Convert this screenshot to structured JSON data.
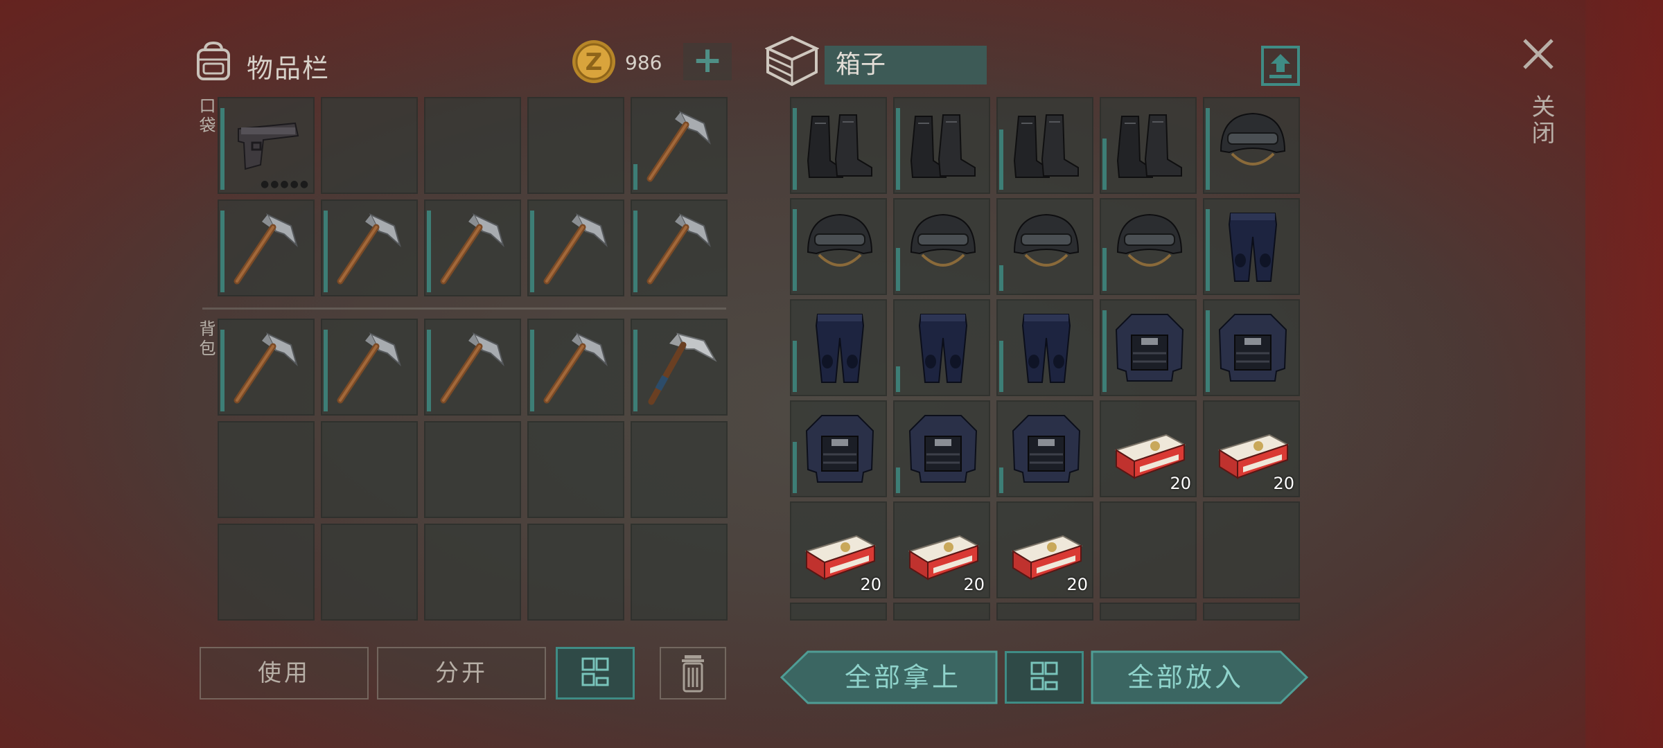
{
  "inventory": {
    "title": "物品栏",
    "coins": "986",
    "add_coins": "+",
    "pocket_label": "口袋",
    "backpack_label": "背包"
  },
  "container": {
    "name": "箱子",
    "close_label": "关闭"
  },
  "inventory_slots": [
    {
      "item": "pistol-icon",
      "bar": 0.95
    },
    {
      "item": "empty"
    },
    {
      "item": "empty"
    },
    {
      "item": "empty"
    },
    {
      "item": "pickaxe-icon",
      "bar": 0.3
    },
    {
      "item": "pickaxe-icon",
      "bar": 0.95
    },
    {
      "item": "pickaxe-icon",
      "bar": 0.95
    },
    {
      "item": "pickaxe-icon",
      "bar": 0.95
    },
    {
      "item": "pickaxe-icon",
      "bar": 0.95
    },
    {
      "item": "pickaxe-icon",
      "bar": 0.95
    },
    {
      "item": "pickaxe-icon",
      "bar": 0.95
    },
    {
      "item": "pickaxe-icon",
      "bar": 0.95
    },
    {
      "item": "pickaxe-icon",
      "bar": 0.95
    },
    {
      "item": "pickaxe-icon",
      "bar": 0.95
    },
    {
      "item": "ice-axe-icon",
      "bar": 0.95
    }
  ],
  "container_slots": [
    {
      "item": "boots-icon",
      "bar": 0.95
    },
    {
      "item": "boots-icon",
      "bar": 0.95
    },
    {
      "item": "boots-icon",
      "bar": 0.7
    },
    {
      "item": "boots-icon",
      "bar": 0.6
    },
    {
      "item": "helmet-icon",
      "bar": 0.95
    },
    {
      "item": "helmet-icon",
      "bar": 0.95
    },
    {
      "item": "helmet-icon",
      "bar": 0.5
    },
    {
      "item": "helmet-icon",
      "bar": 0.3
    },
    {
      "item": "helmet-icon",
      "bar": 0.5
    },
    {
      "item": "pants-icon",
      "bar": 0.95
    },
    {
      "item": "pants-icon",
      "bar": 0.6
    },
    {
      "item": "pants-icon",
      "bar": 0.3
    },
    {
      "item": "pants-icon",
      "bar": 0.6
    },
    {
      "item": "vest-icon",
      "bar": 0.95
    },
    {
      "item": "vest-icon",
      "bar": 0.95
    },
    {
      "item": "vest-icon",
      "bar": 0.6
    },
    {
      "item": "vest-icon",
      "bar": 0.3
    },
    {
      "item": "vest-icon",
      "bar": 0.3
    },
    {
      "item": "cigarettes-icon",
      "qty": "20"
    },
    {
      "item": "cigarettes-icon",
      "qty": "20"
    },
    {
      "item": "cigarettes-icon",
      "qty": "20"
    },
    {
      "item": "cigarettes-icon",
      "qty": "20"
    },
    {
      "item": "cigarettes-icon",
      "qty": "20"
    },
    {
      "item": "empty"
    },
    {
      "item": "empty"
    }
  ],
  "buttons": {
    "use": "使用",
    "split": "分开",
    "take_all": "全部拿上",
    "put_all": "全部放入"
  },
  "colors": {
    "accent": "#3f8c85",
    "slot": "#363a36"
  }
}
